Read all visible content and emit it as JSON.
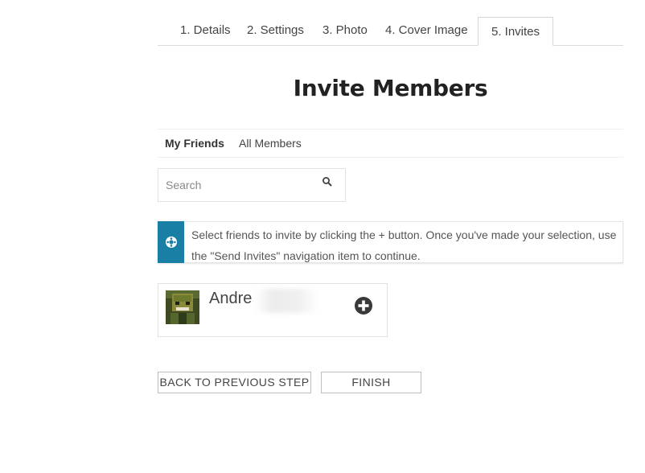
{
  "tabs": [
    {
      "label": "1. Details"
    },
    {
      "label": "2. Settings"
    },
    {
      "label": "3. Photo"
    },
    {
      "label": "4. Cover Image"
    },
    {
      "label": "5. Invites",
      "active": true
    }
  ],
  "page_title": "Invite Members",
  "subnav": {
    "items": [
      {
        "label": "My Friends",
        "active": true
      },
      {
        "label": "All Members"
      }
    ]
  },
  "search": {
    "placeholder": "Search",
    "value": "",
    "icon": "search-icon"
  },
  "notice": {
    "icon": "info-icon",
    "text": "Select friends to invite by clicking the + button. Once you've made your selection, use the \"Send Invites\" navigation item to continue.",
    "accent_color": "#1a7fa4"
  },
  "members": [
    {
      "name": "Andre",
      "avatar": "avatar",
      "action_icon": "plus-circle-icon"
    }
  ],
  "buttons": {
    "back": "BACK TO PREVIOUS STEP",
    "finish": "FINISH"
  }
}
